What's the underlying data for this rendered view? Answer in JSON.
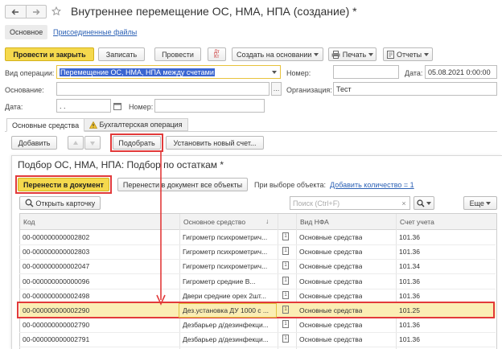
{
  "window": {
    "title": "Внутреннее перемещение ОС, НМА, НПА (создание) *",
    "back_icon": "arrow-left-icon",
    "forward_icon": "arrow-right-icon",
    "star_icon": "star-icon"
  },
  "tabs_top": [
    {
      "label": "Основное"
    },
    {
      "label": "Присоединенные файлы"
    }
  ],
  "toolbar": {
    "post_close": "Провести и закрыть",
    "save": "Записать",
    "post": "Провести",
    "dtkt": "Дт\nКт",
    "create_based": "Создать на основании",
    "print": "Печать",
    "reports": "Отчеты"
  },
  "form": {
    "op_type_label": "Вид операции:",
    "op_type_value": "Перемещение ОС, НМА, НПА между счетами",
    "number_label": "Номер:",
    "number_value": "",
    "date_label": "Дата:",
    "date_value": "05.08.2021  0:00:00",
    "basis_label": "Основание:",
    "basis_value": "",
    "org_label": "Организация:",
    "org_value": "Тест",
    "date2_label": "Дата:",
    "date2_value": "  .  .",
    "number2_label": "Номер:",
    "number2_value": ""
  },
  "section_tabs": [
    {
      "label": "Основные средства"
    },
    {
      "label": "Бухгалтерская операция"
    }
  ],
  "table_toolbar": {
    "add": "Добавить",
    "pick": "Подобрать",
    "set_account": "Установить новый счет..."
  },
  "picker": {
    "title": "Подбор ОС, НМА, НПА: Подбор по остаткам *",
    "transfer": "Перенести в документ",
    "transfer_all": "Перенести в документ все объекты",
    "on_select_label": "При выборе объекта:",
    "add_qty_link": "Добавить количество = 1",
    "open_card": "Открыть карточку",
    "search_placeholder": "Поиск (Ctrl+F)",
    "more": "Еще",
    "columns": [
      "Код",
      "Основное средство",
      "Вид НФА",
      "Счет учета"
    ],
    "rows": [
      {
        "code": "00-000000000002802",
        "asset": "Гигрометр психрометрич...",
        "kind": "Основные средства",
        "account": "101.36"
      },
      {
        "code": "00-000000000002803",
        "asset": "Гигрометр психрометрич...",
        "kind": "Основные средства",
        "account": "101.36"
      },
      {
        "code": "00-000000000002047",
        "asset": "Гигрометр психрометрич...",
        "kind": "Основные средства",
        "account": "101.34"
      },
      {
        "code": "00-000000000000096",
        "asset": "Гигрометр средние В...",
        "kind": "Основные средства",
        "account": "101.36"
      },
      {
        "code": "00-000000000002498",
        "asset": "Двери средние орех 2шт...",
        "kind": "Основные средства",
        "account": "101.36"
      },
      {
        "code": "00-000000000002290",
        "asset": "Дез.установка ДУ 1000 с ...",
        "kind": "Основные средства",
        "account": "101.25"
      },
      {
        "code": "00-000000000002790",
        "asset": "Дезбарьер д/дезинфекци...",
        "kind": "Основные средства",
        "account": "101.36"
      },
      {
        "code": "00-000000000002791",
        "asset": "Дезбарьер д/дезинфекци...",
        "kind": "Основные средства",
        "account": "101.36"
      }
    ]
  },
  "colors": {
    "accent_yellow": "#f5d94d",
    "highlight_row": "#fbeeb4",
    "annotation_red": "#e23a3a",
    "link_blue": "#2c61b5"
  }
}
